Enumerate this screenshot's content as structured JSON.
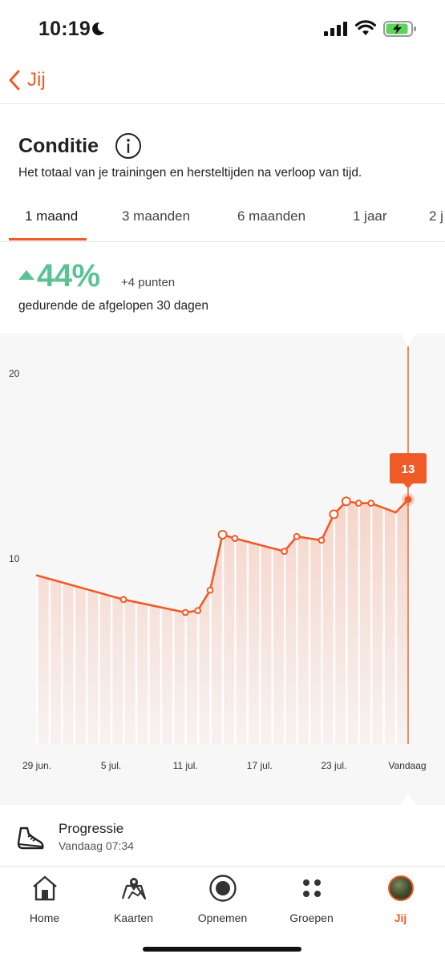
{
  "status_bar": {
    "time": "10:19"
  },
  "nav": {
    "back_label": "Jij"
  },
  "header": {
    "title": "Conditie",
    "subtitle": "Het totaal van je trainingen en hersteltijden na verloop van tijd."
  },
  "tabs": [
    {
      "label": "1 maand",
      "active": true
    },
    {
      "label": "3 maanden",
      "active": false
    },
    {
      "label": "6 maanden",
      "active": false
    },
    {
      "label": "1 jaar",
      "active": false
    },
    {
      "label": "2 j",
      "active": false
    }
  ],
  "summary": {
    "percent": "44%",
    "points": "+4 punten",
    "period": "gedurende de afgelopen 30 dagen"
  },
  "colors": {
    "accent": "#ef5b26",
    "positive": "#5cc293"
  },
  "chart_data": {
    "type": "area",
    "y_ticks": [
      "20",
      "10"
    ],
    "y_tick_values": [
      20,
      10
    ],
    "ylim": [
      0,
      20
    ],
    "x_ticks": [
      "29 jun.",
      "5 jul.",
      "11 jul.",
      "17 jul.",
      "23 jul.",
      "Vandaag"
    ],
    "selected_label": "13",
    "series": [
      {
        "values": [
          9.1,
          7.8,
          7.1,
          7.2,
          8.3,
          11.3,
          11.1,
          10.4,
          11.2,
          11.0,
          12.4,
          13.1,
          13.0,
          13.0,
          12.5,
          13.2
        ],
        "day_index": [
          0,
          7,
          12,
          13,
          14,
          15,
          16,
          20,
          21,
          23,
          24,
          25,
          26,
          27,
          29,
          30
        ],
        "markers": [
          false,
          true,
          true,
          true,
          true,
          true,
          true,
          true,
          true,
          true,
          true,
          true,
          true,
          true,
          false,
          true
        ]
      }
    ]
  },
  "activity": {
    "title": "Progressie",
    "time": "Vandaag 07:34"
  },
  "tabbar": [
    {
      "label": "Home",
      "icon": "home-icon",
      "active": false
    },
    {
      "label": "Kaarten",
      "icon": "map-icon",
      "active": false
    },
    {
      "label": "Opnemen",
      "icon": "record-icon",
      "active": false
    },
    {
      "label": "Groepen",
      "icon": "groups-icon",
      "active": false
    },
    {
      "label": "Jij",
      "icon": "avatar-icon",
      "active": true
    }
  ]
}
